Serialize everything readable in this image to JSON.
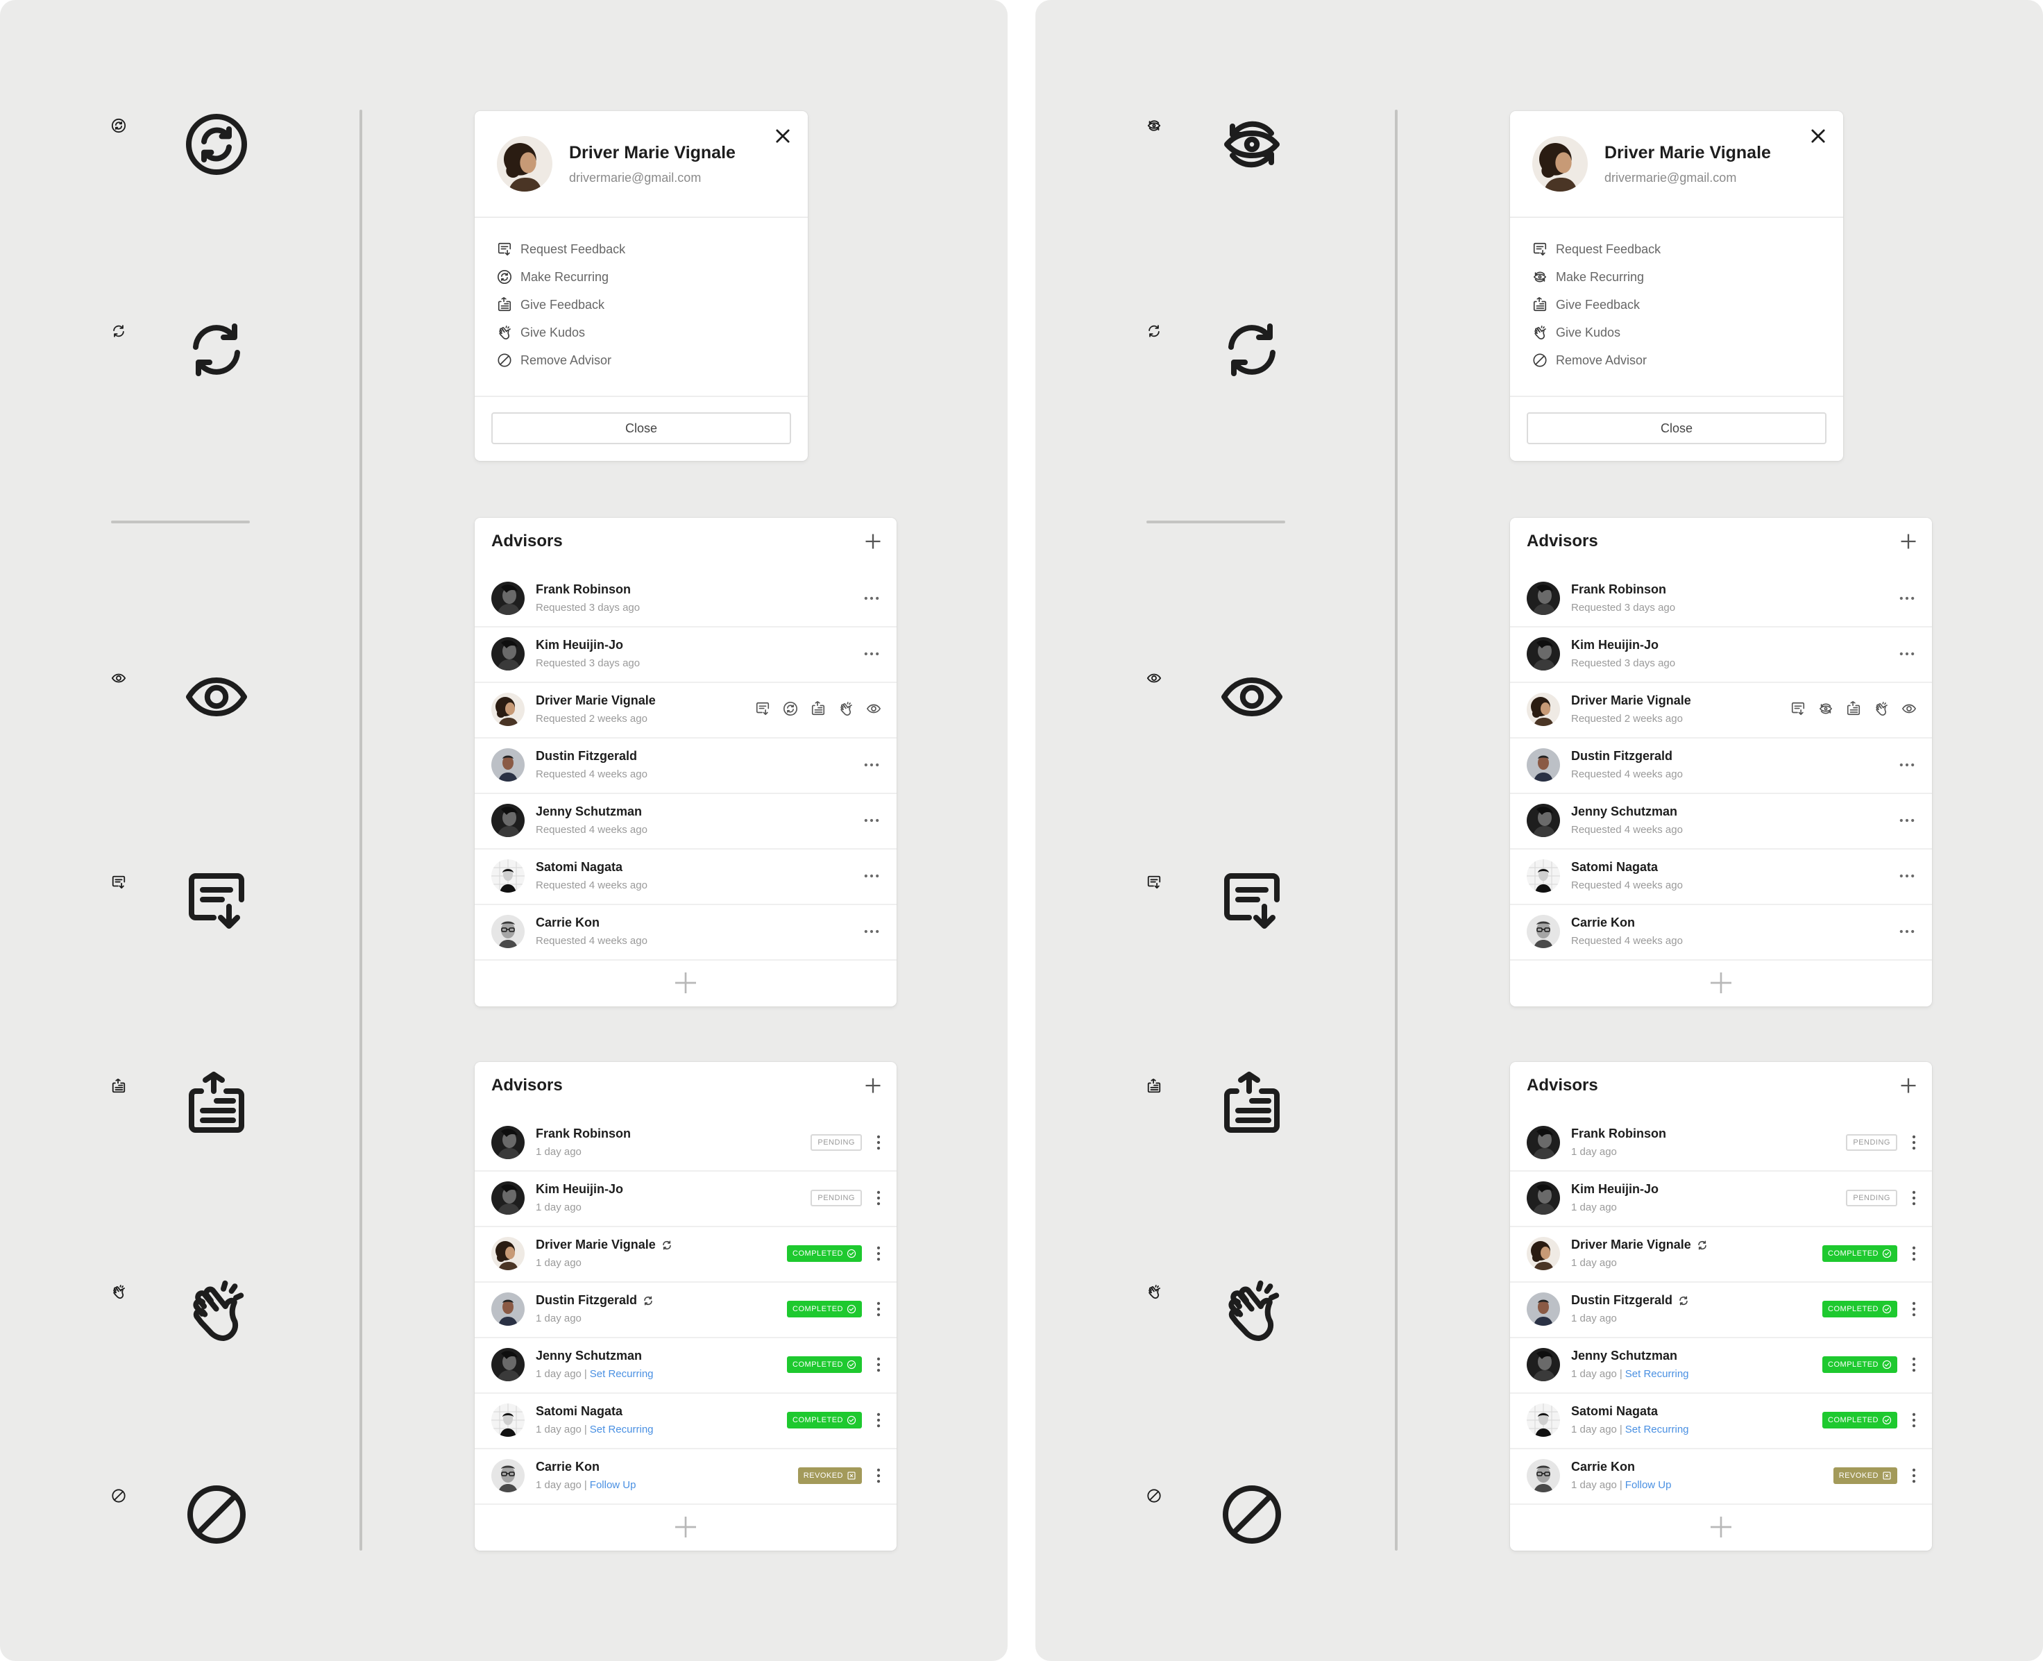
{
  "panels": [
    {
      "id": "left",
      "recurring_style": "circle",
      "popover": {
        "name": "Driver Marie Vignale",
        "email": "drivermarie@gmail.com",
        "menu": [
          {
            "icon": "request-feedback-icon",
            "label": "Request Feedback"
          },
          {
            "icon": "make-recurring-icon",
            "label": "Make Recurring"
          },
          {
            "icon": "give-feedback-icon",
            "label": "Give Feedback"
          },
          {
            "icon": "give-kudos-icon",
            "label": "Give Kudos"
          },
          {
            "icon": "remove-advisor-icon",
            "label": "Remove Advisor"
          }
        ],
        "close_label": "Close"
      }
    },
    {
      "id": "right",
      "recurring_style": "eye",
      "popover": {
        "name": "Driver Marie Vignale",
        "email": "drivermarie@gmail.com",
        "menu": [
          {
            "icon": "request-feedback-icon",
            "label": "Request Feedback"
          },
          {
            "icon": "make-recurring-icon",
            "label": "Make Recurring"
          },
          {
            "icon": "give-feedback-icon",
            "label": "Give Feedback"
          },
          {
            "icon": "give-kudos-icon",
            "label": "Give Kudos"
          },
          {
            "icon": "remove-advisor-icon",
            "label": "Remove Advisor"
          }
        ],
        "close_label": "Close"
      }
    }
  ],
  "icon_legend": [
    "make-recurring-icon",
    "sync-icon",
    "eye-icon",
    "request-feedback-icon",
    "give-feedback-icon",
    "give-kudos-icon",
    "remove-advisor-icon"
  ],
  "advisors_requested": {
    "title": "Advisors",
    "rows": [
      {
        "name": "Frank Robinson",
        "sub": "Requested 3 days ago",
        "avatar": "dark"
      },
      {
        "name": "Kim Heuijin-Jo",
        "sub": "Requested 3 days ago",
        "avatar": "dark"
      },
      {
        "name": "Driver Marie Vignale",
        "sub": "Requested 2 weeks ago",
        "avatar": "curly",
        "hovered": true
      },
      {
        "name": "Dustin Fitzgerald",
        "sub": "Requested 4 weeks ago",
        "avatar": "light"
      },
      {
        "name": "Jenny Schutzman",
        "sub": "Requested 4 weeks ago",
        "avatar": "dark"
      },
      {
        "name": "Satomi Nagata",
        "sub": "Requested 4 weeks ago",
        "avatar": "grid"
      },
      {
        "name": "Carrie Kon",
        "sub": "Requested 4 weeks ago",
        "avatar": "glasses"
      }
    ]
  },
  "advisors_status": {
    "title": "Advisors",
    "rows": [
      {
        "name": "Frank Robinson",
        "sub": "1 day ago",
        "status": "PENDING",
        "recurring": false,
        "link": "",
        "avatar": "dark"
      },
      {
        "name": "Kim Heuijin-Jo",
        "sub": "1 day ago",
        "status": "PENDING",
        "recurring": false,
        "link": "",
        "avatar": "dark"
      },
      {
        "name": "Driver Marie Vignale",
        "sub": "1 day ago",
        "status": "COMPLETED",
        "recurring": true,
        "link": "",
        "avatar": "curly"
      },
      {
        "name": "Dustin Fitzgerald",
        "sub": "1 day ago",
        "status": "COMPLETED",
        "recurring": true,
        "link": "",
        "avatar": "light"
      },
      {
        "name": "Jenny Schutzman",
        "sub": "1 day ago",
        "status": "COMPLETED",
        "recurring": false,
        "link": "Set Recurring",
        "avatar": "dark"
      },
      {
        "name": "Satomi Nagata",
        "sub": "1 day ago",
        "status": "COMPLETED",
        "recurring": false,
        "link": "Set Recurring",
        "avatar": "grid"
      },
      {
        "name": "Carrie Kon",
        "sub": "1 day ago",
        "status": "REVOKED",
        "recurring": false,
        "link": "Follow Up",
        "avatar": "glasses"
      }
    ]
  },
  "colors": {
    "completed": "#1ec92f",
    "revoked": "#a39a5a",
    "link": "#4a90e2",
    "panel_bg": "#ebebea"
  }
}
